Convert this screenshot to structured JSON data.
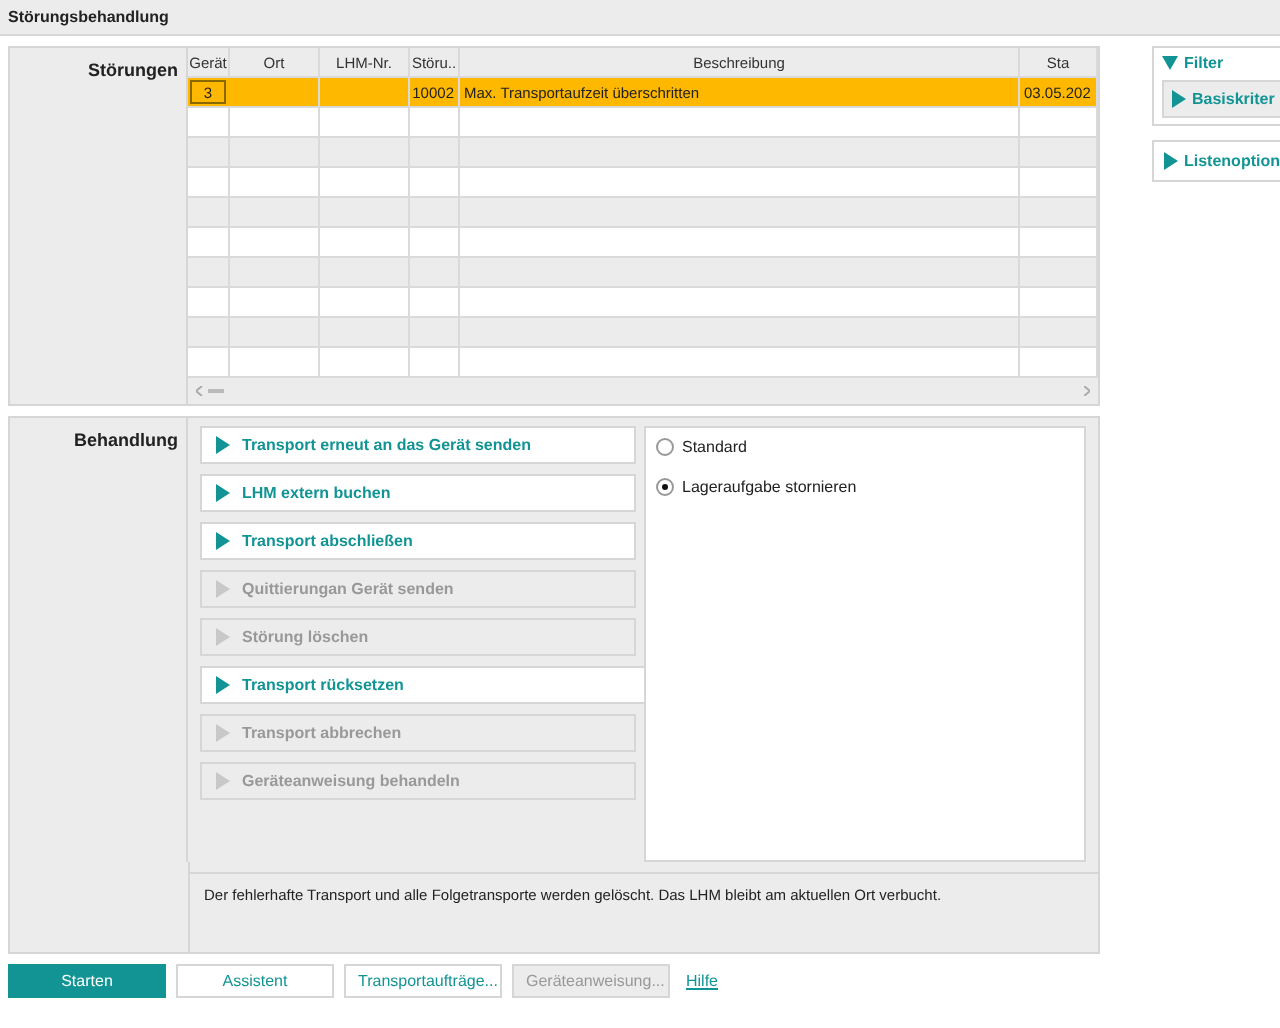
{
  "window": {
    "title": "Störungsbehandlung"
  },
  "stoerungen": {
    "label": "Störungen",
    "columns": [
      "Gerät",
      "Ort",
      "LHM-Nr.",
      "Störu..",
      "Beschreibung",
      "Sta"
    ],
    "rows": [
      {
        "selected": true,
        "cells": [
          "3",
          "",
          "",
          "10002",
          "Max. Transportaufzeit überschritten",
          "03.05.202"
        ]
      }
    ]
  },
  "filter": {
    "title": "Filter",
    "expanded": true,
    "sections": [
      {
        "title": "Basiskriter",
        "expanded": false
      }
    ]
  },
  "listenoptionen": {
    "title": "Listenoption",
    "expanded": false
  },
  "behandlung": {
    "label": "Behandlung",
    "actions": [
      {
        "label": "Transport erneut an das Gerät senden",
        "disabled": false
      },
      {
        "label": "LHM extern buchen",
        "disabled": false
      },
      {
        "label": "Transport abschließen",
        "disabled": false
      },
      {
        "label": "Quittierungan Gerät senden",
        "disabled": true
      },
      {
        "label": "Störung löschen",
        "disabled": true
      },
      {
        "label": "Transport rücksetzen",
        "disabled": false,
        "selected": true
      },
      {
        "label": "Transport abbrechen",
        "disabled": true
      },
      {
        "label": "Geräteanweisung behandeln",
        "disabled": true
      }
    ],
    "options": [
      {
        "label": "Standard",
        "selected": false
      },
      {
        "label": "Lageraufgabe stornieren",
        "selected": true
      }
    ],
    "description": "Der fehlerhafte Transport und alle Folgetransporte werden gelöscht. Das LHM bleibt am aktuellen Ort verbucht."
  },
  "buttons": [
    {
      "label": "Starten",
      "kind": "primary",
      "disabled": false
    },
    {
      "label": "Assistent",
      "kind": "secondary",
      "disabled": false
    },
    {
      "label": "Transportaufträge...",
      "kind": "secondary",
      "disabled": false
    },
    {
      "label": "Geräteanweisung...",
      "kind": "secondary",
      "disabled": true
    },
    {
      "label": "Hilfe",
      "kind": "link"
    }
  ]
}
